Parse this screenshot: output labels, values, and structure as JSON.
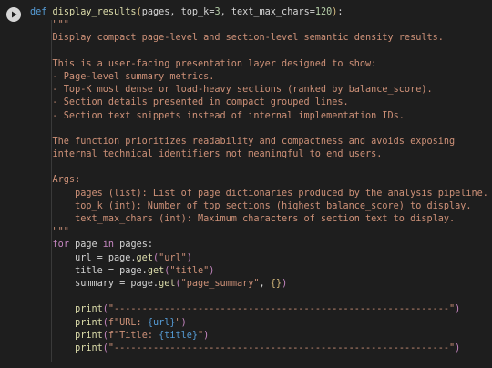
{
  "cell": {
    "run_button_icon": "play-icon",
    "lines": [
      [
        {
          "t": "def ",
          "c": "kw"
        },
        {
          "t": "display_results",
          "c": "fn"
        },
        {
          "t": "(",
          "c": "br"
        },
        {
          "t": "pages, top_k",
          "c": "txt"
        },
        {
          "t": "=",
          "c": "txt"
        },
        {
          "t": "3",
          "c": "num"
        },
        {
          "t": ", text_max_chars",
          "c": "txt"
        },
        {
          "t": "=",
          "c": "txt"
        },
        {
          "t": "120",
          "c": "num"
        },
        {
          "t": ")",
          "c": "br"
        },
        {
          "t": ":",
          "c": "txt"
        }
      ],
      [
        {
          "t": "    \"\"\"",
          "c": "doc"
        }
      ],
      [
        {
          "t": "    Display compact page-level and section-level semantic density results.",
          "c": "doc"
        }
      ],
      [
        {
          "t": "",
          "c": "doc"
        }
      ],
      [
        {
          "t": "    This is a user-facing presentation layer designed to show:",
          "c": "doc"
        }
      ],
      [
        {
          "t": "    - Page-level summary metrics.",
          "c": "doc"
        }
      ],
      [
        {
          "t": "    - Top-K most dense or load-heavy sections (ranked by balance_score).",
          "c": "doc"
        }
      ],
      [
        {
          "t": "    - Section details presented in compact grouped lines.",
          "c": "doc"
        }
      ],
      [
        {
          "t": "    - Section text snippets instead of internal implementation IDs.",
          "c": "doc"
        }
      ],
      [
        {
          "t": "",
          "c": "doc"
        }
      ],
      [
        {
          "t": "    The function prioritizes readability and compactness and avoids exposing",
          "c": "doc"
        }
      ],
      [
        {
          "t": "    internal technical identifiers not meaningful to end users.",
          "c": "doc"
        }
      ],
      [
        {
          "t": "",
          "c": "doc"
        }
      ],
      [
        {
          "t": "    Args:",
          "c": "doc"
        }
      ],
      [
        {
          "t": "        pages (list): List of page dictionaries produced by the analysis pipeline.",
          "c": "doc"
        }
      ],
      [
        {
          "t": "        top_k (int): Number of top sections (highest balance_score) to display.",
          "c": "doc"
        }
      ],
      [
        {
          "t": "        text_max_chars (int): Maximum characters of section text to display.",
          "c": "doc"
        }
      ],
      [
        {
          "t": "    \"\"\"",
          "c": "doc"
        }
      ],
      [
        {
          "t": "    ",
          "c": "txt"
        },
        {
          "t": "for",
          "c": "kw2"
        },
        {
          "t": " page ",
          "c": "txt"
        },
        {
          "t": "in",
          "c": "kw2"
        },
        {
          "t": " pages:",
          "c": "txt"
        }
      ],
      [
        {
          "t": "        url = page.",
          "c": "txt"
        },
        {
          "t": "get",
          "c": "fn"
        },
        {
          "t": "(",
          "c": "br2"
        },
        {
          "t": "\"url\"",
          "c": "str"
        },
        {
          "t": ")",
          "c": "br2"
        }
      ],
      [
        {
          "t": "        title = page.",
          "c": "txt"
        },
        {
          "t": "get",
          "c": "fn"
        },
        {
          "t": "(",
          "c": "br2"
        },
        {
          "t": "\"title\"",
          "c": "str"
        },
        {
          "t": ")",
          "c": "br2"
        }
      ],
      [
        {
          "t": "        summary = page.",
          "c": "txt"
        },
        {
          "t": "get",
          "c": "fn"
        },
        {
          "t": "(",
          "c": "br2"
        },
        {
          "t": "\"page_summary\"",
          "c": "str"
        },
        {
          "t": ", ",
          "c": "txt"
        },
        {
          "t": "{}",
          "c": "br"
        },
        {
          "t": ")",
          "c": "br2"
        }
      ],
      [
        {
          "t": "",
          "c": "txt"
        }
      ],
      [
        {
          "t": "        ",
          "c": "txt"
        },
        {
          "t": "print",
          "c": "fn"
        },
        {
          "t": "(",
          "c": "br2"
        },
        {
          "t": "\"------------------------------------------------------------\"",
          "c": "str"
        },
        {
          "t": ")",
          "c": "br2"
        }
      ],
      [
        {
          "t": "        ",
          "c": "txt"
        },
        {
          "t": "print",
          "c": "fn"
        },
        {
          "t": "(",
          "c": "br2"
        },
        {
          "t": "f\"URL: ",
          "c": "str"
        },
        {
          "t": "{url}",
          "c": "kw"
        },
        {
          "t": "\"",
          "c": "str"
        },
        {
          "t": ")",
          "c": "br2"
        }
      ],
      [
        {
          "t": "        ",
          "c": "txt"
        },
        {
          "t": "print",
          "c": "fn"
        },
        {
          "t": "(",
          "c": "br2"
        },
        {
          "t": "f\"Title: ",
          "c": "str"
        },
        {
          "t": "{title}",
          "c": "kw"
        },
        {
          "t": "\"",
          "c": "str"
        },
        {
          "t": ")",
          "c": "br2"
        }
      ],
      [
        {
          "t": "        ",
          "c": "txt"
        },
        {
          "t": "print",
          "c": "fn"
        },
        {
          "t": "(",
          "c": "br2"
        },
        {
          "t": "\"------------------------------------------------------------\"",
          "c": "str"
        },
        {
          "t": ")",
          "c": "br2"
        }
      ]
    ]
  }
}
